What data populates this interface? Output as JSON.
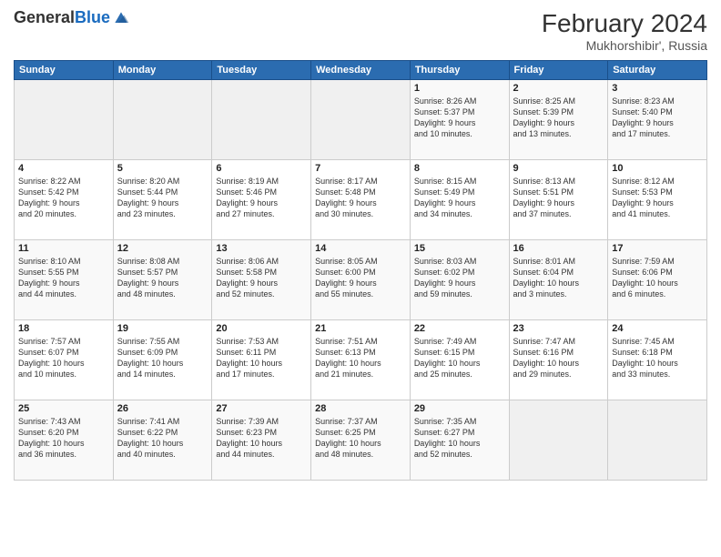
{
  "header": {
    "logo_general": "General",
    "logo_blue": "Blue",
    "month_title": "February 2024",
    "location": "Mukhorshibir', Russia"
  },
  "days_of_week": [
    "Sunday",
    "Monday",
    "Tuesday",
    "Wednesday",
    "Thursday",
    "Friday",
    "Saturday"
  ],
  "weeks": [
    [
      {
        "day": "",
        "info": ""
      },
      {
        "day": "",
        "info": ""
      },
      {
        "day": "",
        "info": ""
      },
      {
        "day": "",
        "info": ""
      },
      {
        "day": "1",
        "info": "Sunrise: 8:26 AM\nSunset: 5:37 PM\nDaylight: 9 hours\nand 10 minutes."
      },
      {
        "day": "2",
        "info": "Sunrise: 8:25 AM\nSunset: 5:39 PM\nDaylight: 9 hours\nand 13 minutes."
      },
      {
        "day": "3",
        "info": "Sunrise: 8:23 AM\nSunset: 5:40 PM\nDaylight: 9 hours\nand 17 minutes."
      }
    ],
    [
      {
        "day": "4",
        "info": "Sunrise: 8:22 AM\nSunset: 5:42 PM\nDaylight: 9 hours\nand 20 minutes."
      },
      {
        "day": "5",
        "info": "Sunrise: 8:20 AM\nSunset: 5:44 PM\nDaylight: 9 hours\nand 23 minutes."
      },
      {
        "day": "6",
        "info": "Sunrise: 8:19 AM\nSunset: 5:46 PM\nDaylight: 9 hours\nand 27 minutes."
      },
      {
        "day": "7",
        "info": "Sunrise: 8:17 AM\nSunset: 5:48 PM\nDaylight: 9 hours\nand 30 minutes."
      },
      {
        "day": "8",
        "info": "Sunrise: 8:15 AM\nSunset: 5:49 PM\nDaylight: 9 hours\nand 34 minutes."
      },
      {
        "day": "9",
        "info": "Sunrise: 8:13 AM\nSunset: 5:51 PM\nDaylight: 9 hours\nand 37 minutes."
      },
      {
        "day": "10",
        "info": "Sunrise: 8:12 AM\nSunset: 5:53 PM\nDaylight: 9 hours\nand 41 minutes."
      }
    ],
    [
      {
        "day": "11",
        "info": "Sunrise: 8:10 AM\nSunset: 5:55 PM\nDaylight: 9 hours\nand 44 minutes."
      },
      {
        "day": "12",
        "info": "Sunrise: 8:08 AM\nSunset: 5:57 PM\nDaylight: 9 hours\nand 48 minutes."
      },
      {
        "day": "13",
        "info": "Sunrise: 8:06 AM\nSunset: 5:58 PM\nDaylight: 9 hours\nand 52 minutes."
      },
      {
        "day": "14",
        "info": "Sunrise: 8:05 AM\nSunset: 6:00 PM\nDaylight: 9 hours\nand 55 minutes."
      },
      {
        "day": "15",
        "info": "Sunrise: 8:03 AM\nSunset: 6:02 PM\nDaylight: 9 hours\nand 59 minutes."
      },
      {
        "day": "16",
        "info": "Sunrise: 8:01 AM\nSunset: 6:04 PM\nDaylight: 10 hours\nand 3 minutes."
      },
      {
        "day": "17",
        "info": "Sunrise: 7:59 AM\nSunset: 6:06 PM\nDaylight: 10 hours\nand 6 minutes."
      }
    ],
    [
      {
        "day": "18",
        "info": "Sunrise: 7:57 AM\nSunset: 6:07 PM\nDaylight: 10 hours\nand 10 minutes."
      },
      {
        "day": "19",
        "info": "Sunrise: 7:55 AM\nSunset: 6:09 PM\nDaylight: 10 hours\nand 14 minutes."
      },
      {
        "day": "20",
        "info": "Sunrise: 7:53 AM\nSunset: 6:11 PM\nDaylight: 10 hours\nand 17 minutes."
      },
      {
        "day": "21",
        "info": "Sunrise: 7:51 AM\nSunset: 6:13 PM\nDaylight: 10 hours\nand 21 minutes."
      },
      {
        "day": "22",
        "info": "Sunrise: 7:49 AM\nSunset: 6:15 PM\nDaylight: 10 hours\nand 25 minutes."
      },
      {
        "day": "23",
        "info": "Sunrise: 7:47 AM\nSunset: 6:16 PM\nDaylight: 10 hours\nand 29 minutes."
      },
      {
        "day": "24",
        "info": "Sunrise: 7:45 AM\nSunset: 6:18 PM\nDaylight: 10 hours\nand 33 minutes."
      }
    ],
    [
      {
        "day": "25",
        "info": "Sunrise: 7:43 AM\nSunset: 6:20 PM\nDaylight: 10 hours\nand 36 minutes."
      },
      {
        "day": "26",
        "info": "Sunrise: 7:41 AM\nSunset: 6:22 PM\nDaylight: 10 hours\nand 40 minutes."
      },
      {
        "day": "27",
        "info": "Sunrise: 7:39 AM\nSunset: 6:23 PM\nDaylight: 10 hours\nand 44 minutes."
      },
      {
        "day": "28",
        "info": "Sunrise: 7:37 AM\nSunset: 6:25 PM\nDaylight: 10 hours\nand 48 minutes."
      },
      {
        "day": "29",
        "info": "Sunrise: 7:35 AM\nSunset: 6:27 PM\nDaylight: 10 hours\nand 52 minutes."
      },
      {
        "day": "",
        "info": ""
      },
      {
        "day": "",
        "info": ""
      }
    ]
  ]
}
